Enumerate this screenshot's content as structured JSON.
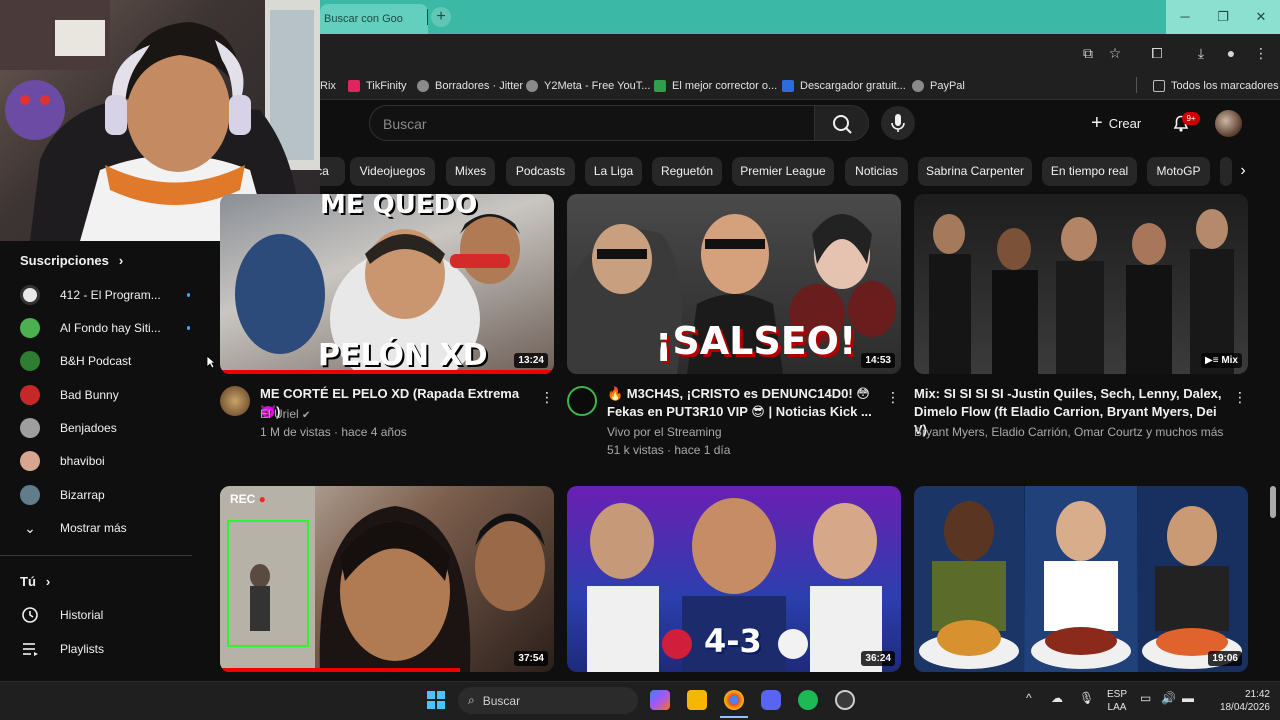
{
  "browser": {
    "tab_title": "Buscar con Goo",
    "new_tab": "+",
    "window_controls": {
      "minimize": "─",
      "restore": "❐",
      "close": "✕"
    },
    "bookmarks": [
      {
        "label": "Rix",
        "color": "#3a3a3a"
      },
      {
        "label": "TikFinity",
        "color": "#e0245e"
      },
      {
        "label": "Borradores · Jitter",
        "color": "#8a8a8a"
      },
      {
        "label": "Y2Meta - Free YouT...",
        "color": "#8a8a8a"
      },
      {
        "label": "El mejor corrector o...",
        "color": "#2e9f4a"
      },
      {
        "label": "Descargador gratuit...",
        "color": "#2d6cdf"
      },
      {
        "label": "PayPal",
        "color": "#8a8a8a"
      }
    ],
    "all_bookmarks": "Todos los marcadores"
  },
  "header": {
    "search_placeholder": "Buscar",
    "create_label": "Crear",
    "notif_badge": "9+"
  },
  "chips": [
    {
      "label": "ca"
    },
    {
      "label": "Videojuegos"
    },
    {
      "label": "Mixes"
    },
    {
      "label": "Podcasts"
    },
    {
      "label": "La Liga"
    },
    {
      "label": "Reguetón"
    },
    {
      "label": "Premier League"
    },
    {
      "label": "Noticias"
    },
    {
      "label": "Sabrina Carpenter"
    },
    {
      "label": "En tiempo real"
    },
    {
      "label": "MotoGP"
    }
  ],
  "sidebar": {
    "subscriptions_title": "Suscripciones",
    "subscriptions": [
      {
        "label": "412 - El Program...",
        "dot": true,
        "color": "#e8e8e8"
      },
      {
        "label": "Al Fondo hay Siti...",
        "dot": true,
        "color": "#4caf50"
      },
      {
        "label": "B&H Podcast",
        "dot": false,
        "color": "#2e7d32"
      },
      {
        "label": "Bad Bunny",
        "dot": false,
        "color": "#c62828"
      },
      {
        "label": "Benjadoes",
        "dot": false,
        "color": "#9e9e9e"
      },
      {
        "label": "bhaviboi",
        "dot": false,
        "color": "#d7a68f"
      },
      {
        "label": "Bizarrap",
        "dot": false,
        "color": "#607d8b"
      }
    ],
    "show_more": "Mostrar más",
    "you_title": "Tú",
    "you_items": [
      {
        "label": "Historial",
        "icon": "history-icon"
      },
      {
        "label": "Playlists",
        "icon": "playlists-icon"
      }
    ]
  },
  "videos": [
    {
      "title": "ME CORTÉ EL PELO XD (Rapada Extrema 👿)",
      "channel": "El Uriel",
      "verified": true,
      "stats": "1 M de vistas · hace 4 años",
      "duration": "13:24",
      "thumb_text_top": "ME QUEDO",
      "thumb_text_bottom": "PELÓN XD"
    },
    {
      "title": "🔥 M3CH4S, ¡CRISTO es DENUNC14D0! 😳 Fekas en PUT3R10 VIP 😎 | Noticias Kick ...",
      "channel": "Vivo por el Streaming",
      "verified": false,
      "stats": "51 k vistas · hace 1 día",
      "duration": "14:53",
      "thumb_text": "¡SALSEO!"
    },
    {
      "title": "Mix: SI SI SI SI -Justin Quiles, Sech, Lenny, Dalex, Dimelo Flow (ft Eladio Carrion, Bryant Myers, Dei V)",
      "channel": "Bryant Myers, Eladio Carrión, Omar Courtz y muchos más",
      "mix_label": "Mix"
    },
    {
      "duration": "37:54",
      "rec_label": "REC"
    },
    {
      "duration": "36:24",
      "score": "4-3"
    },
    {
      "duration": "19:06"
    }
  ],
  "taskbar": {
    "search_label": "Buscar",
    "lang_top": "ESP",
    "lang_bottom": "LAA",
    "time": "21:42",
    "date": "18/04/2026"
  }
}
